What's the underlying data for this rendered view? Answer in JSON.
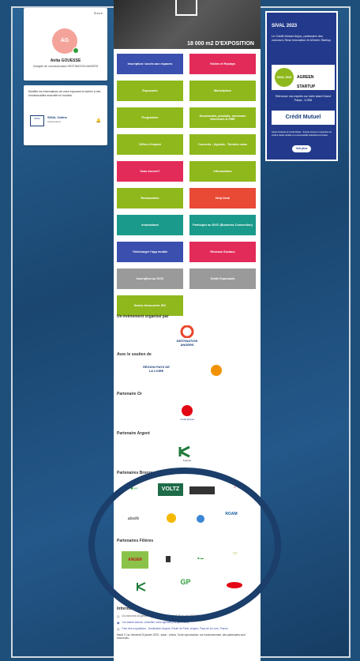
{
  "profile": {
    "suivre": "Suivre",
    "initials": "AG",
    "name": "Anita GOUESSE",
    "role": "Chargée de communication DESTINATION ANGERS"
  },
  "notif": {
    "text": "Modifier les informations de votre exposant et activer à des fonctionnalités essentiel en fonction.",
    "org_logo": "SIVAL",
    "org_name": "SIVAL Online",
    "org_sub": "Organisateur"
  },
  "video": {
    "text": "18 000 m2 D'EXPOSITION"
  },
  "buttons": [
    {
      "label": "Inscription / accès aux espaces",
      "color": "#3a4fae"
    },
    {
      "label": "Visites et Replays",
      "color": "#e32b5a"
    },
    {
      "label": "Exposants",
      "color": "#8fb81c"
    },
    {
      "label": "Marketplace",
      "color": "#8fb81c"
    },
    {
      "label": "Programme",
      "color": "#8fb81c"
    },
    {
      "label": "Nouveautés, produits, nouveaux directeurs & PME",
      "color": "#8fb81c"
    },
    {
      "label": "Offres d'emploi",
      "color": "#8fb81c"
    },
    {
      "label": "Concerts - Agenda - Tendres news",
      "color": "#8fb81c"
    },
    {
      "label": "Vous trouver?",
      "color": "#e32b5a"
    },
    {
      "label": "Informations",
      "color": "#8fb81c"
    },
    {
      "label": "Restauration",
      "color": "#8fb81c"
    },
    {
      "label": "Help Desk",
      "color": "#e84a36"
    },
    {
      "label": "Innovationd",
      "color": "#1a9a8a"
    },
    {
      "label": "Participez au SVIC (Business Connection)",
      "color": "#1a9a8a"
    },
    {
      "label": "Télécharger l'app mobile",
      "color": "#3a4fae"
    },
    {
      "label": "Réseaux Sociaux",
      "color": "#e32b5a"
    },
    {
      "label": "Inscription au SVIC",
      "color": "#9a9a9a"
    },
    {
      "label": "Guide Exposants",
      "color": "#9a9a9a"
    },
    {
      "label": "Nouvs découverte ISO",
      "color": "#8fb81c"
    }
  ],
  "sections": {
    "organise": "Un événement organisé par",
    "soutien": "Avec le soutien de",
    "or": "Partenaire Or",
    "argent": "Partenaire Argent",
    "bronze": "Partenaires Bronze",
    "filieres": "Partenaires Filières",
    "infos": "Informations"
  },
  "logos": {
    "destination": "DESTINATION ANGERS",
    "region": "RÉGION PAYS DE LA LOIRE",
    "credit_mutuel": "Crédit Mutuel",
    "kuppert": "Kuppert",
    "voltz": "VOLTZ",
    "abelle": "abeille",
    "roam": "ROAM",
    "anger": "ANGER"
  },
  "infos": [
    "Du mercredi 18 janvier 2023 09h00 au vendredi 20 janvier 2023 18h00",
    "Les autres salons, consultez notre agenda (Europe/Paris)",
    "Parc des expositions - Destination Angers, Route de Paris, Angers, Pays de la Loire, France"
  ],
  "infos_footer": "Mardi 17 au Vendredi 20 janvier 2023 : salon - retenu. Toute reproduction, sur fonctionnement, des partenaires sont reconnues.",
  "sidebar_ad": {
    "title": "SIVAL 2023",
    "text": "Le Crédit Mutuel Anjou, partenaire des concours Sival Innovation et AGreen Startup.",
    "logo1": "SIVAL 2023",
    "logo2": "AGREEN STARTUP",
    "text2": "Retrouvez nos experts sur notre stand Grand Palais - G.508",
    "brand": "Crédit Mutuel",
    "small": "Caisse Fédérale de Crédit Mutuel - Société anonyme coopérative de crédit à capital variable et à responsabilité statutairement limitée.",
    "button": "Voir plus"
  }
}
